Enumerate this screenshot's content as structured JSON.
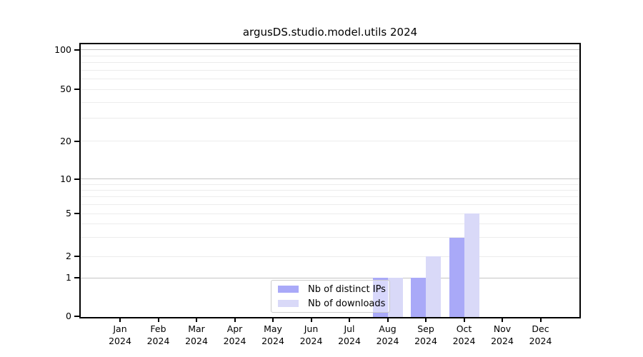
{
  "title": "argusDS.studio.model.utils 2024",
  "chart_data": {
    "type": "bar",
    "title": "argusDS.studio.model.utils 2024",
    "categories": [
      "Jan",
      "Feb",
      "Mar",
      "Apr",
      "May",
      "Jun",
      "Jul",
      "Aug",
      "Sep",
      "Oct",
      "Nov",
      "Dec"
    ],
    "category_year": "2024",
    "series": [
      {
        "name": "Nb of distinct IPs",
        "color": "#a9a9f8",
        "values": [
          0,
          0,
          0,
          0,
          0,
          0,
          0,
          1,
          1,
          3,
          0,
          0
        ]
      },
      {
        "name": "Nb of downloads",
        "color": "#d9d9f8",
        "values": [
          0,
          0,
          0,
          0,
          0,
          0,
          0,
          1,
          2,
          5,
          0,
          0
        ]
      }
    ],
    "yscale": "symlog",
    "ylim": [
      0,
      100
    ],
    "yticks": [
      0,
      1,
      2,
      5,
      10,
      20,
      50,
      100
    ],
    "minor_yticks": [
      3,
      4,
      6,
      7,
      8,
      9,
      30,
      40,
      60,
      70,
      80,
      90
    ],
    "decade_yticks": [
      1,
      10,
      100
    ],
    "grid": "horizontal",
    "legend_position": "lower center inside plot",
    "layout": {
      "y_tick_frac": {
        "0": 0.9965,
        "1": 0.8568,
        "2": 0.7782,
        "5": 0.6212,
        "10": 0.494,
        "20": 0.356,
        "50": 0.1657,
        "100": 0.0209
      },
      "x_first_frac": 0.0788,
      "x_step_frac": 0.07665,
      "bar_width_frac": 0.0301
    }
  },
  "legend": {
    "items": [
      {
        "label": "Nb of distinct IPs",
        "series_index": 0
      },
      {
        "label": "Nb of downloads",
        "series_index": 1
      }
    ]
  },
  "colors": {
    "grid_decade": "#c4c4c4",
    "grid_minor": "#ececec",
    "spine": "#000000",
    "text": "#000000",
    "legend_border": "#cccccc"
  }
}
